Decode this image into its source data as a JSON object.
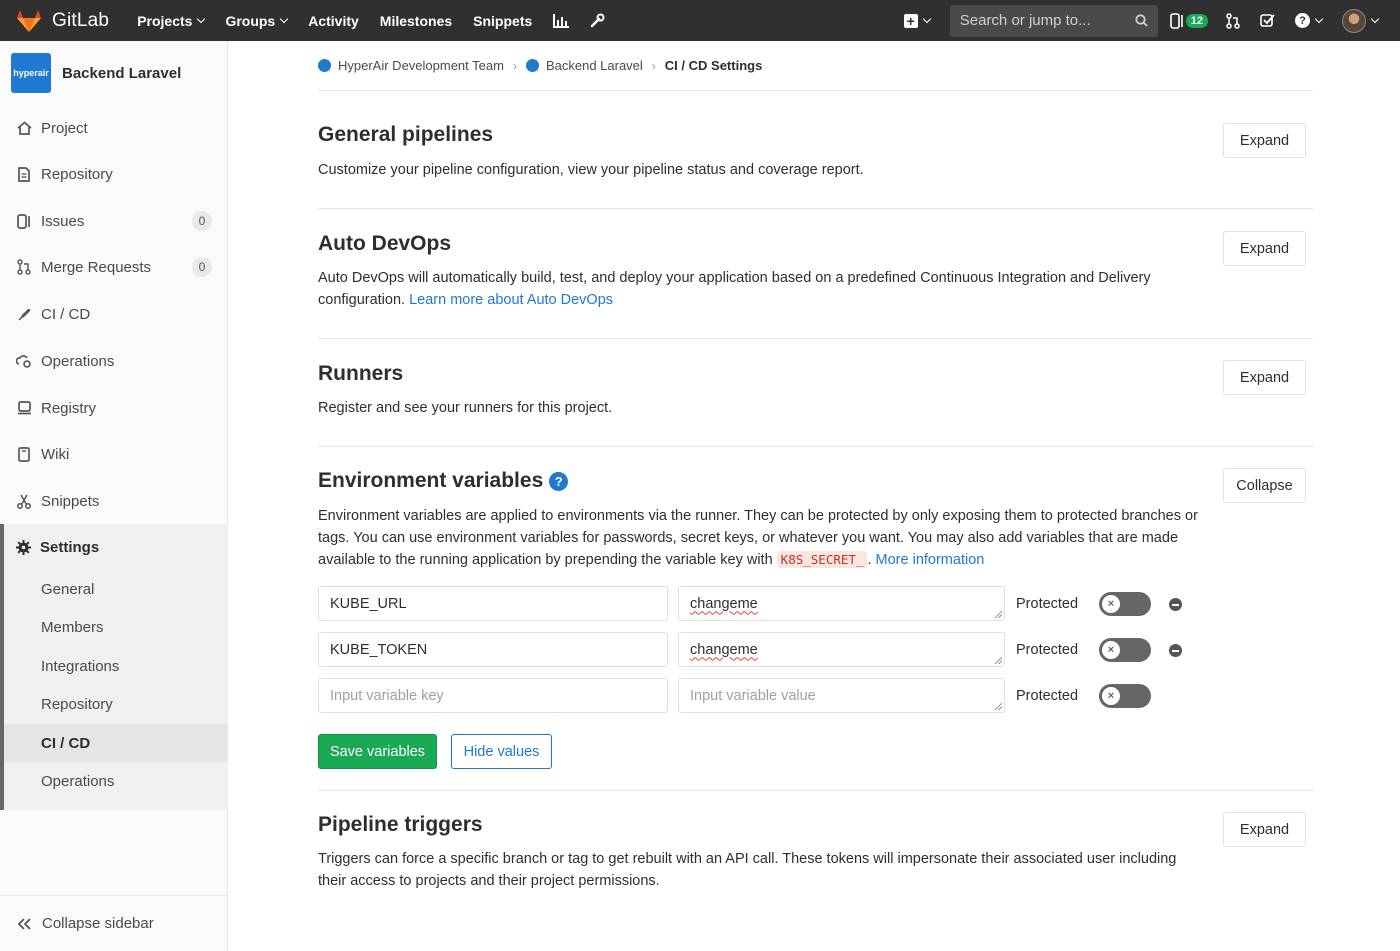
{
  "navbar": {
    "brand": "GitLab",
    "links": [
      {
        "label": "Projects",
        "dropdown": true
      },
      {
        "label": "Groups",
        "dropdown": true
      },
      {
        "label": "Activity",
        "dropdown": false
      },
      {
        "label": "Milestones",
        "dropdown": false
      },
      {
        "label": "Snippets",
        "dropdown": false
      }
    ],
    "search_placeholder": "Search or jump to...",
    "issues_count": "12"
  },
  "sidebar": {
    "project_logo_text": "hyperair",
    "project_name": "Backend Laravel",
    "items": [
      {
        "label": "Project",
        "icon": "home-icon"
      },
      {
        "label": "Repository",
        "icon": "doc-icon"
      },
      {
        "label": "Issues",
        "icon": "issues-icon",
        "count": "0"
      },
      {
        "label": "Merge Requests",
        "icon": "merge-request-icon",
        "count": "0"
      },
      {
        "label": "CI / CD",
        "icon": "rocket-icon"
      },
      {
        "label": "Operations",
        "icon": "cloud-gear-icon"
      },
      {
        "label": "Registry",
        "icon": "container-icon"
      },
      {
        "label": "Wiki",
        "icon": "book-icon"
      },
      {
        "label": "Snippets",
        "icon": "scissors-icon"
      }
    ],
    "settings_label": "Settings",
    "settings_sub": [
      "General",
      "Members",
      "Integrations",
      "Repository",
      "CI / CD",
      "Operations"
    ],
    "active_sub": "CI / CD",
    "collapse_label": "Collapse sidebar"
  },
  "breadcrumb": {
    "group": "HyperAir Development Team",
    "project": "Backend Laravel",
    "current": "CI / CD Settings"
  },
  "sections": {
    "general": {
      "title": "General pipelines",
      "desc": "Customize your pipeline configuration, view your pipeline status and coverage report.",
      "button": "Expand"
    },
    "autodevops": {
      "title": "Auto DevOps",
      "desc": "Auto DevOps will automatically build, test, and deploy your application based on a predefined Continuous Integration and Delivery configuration.",
      "link": "Learn more about Auto DevOps",
      "button": "Expand"
    },
    "runners": {
      "title": "Runners",
      "desc": "Register and see your runners for this project.",
      "button": "Expand"
    },
    "envvars": {
      "title": "Environment variables",
      "desc_pre": "Environment variables are applied to environments via the runner. They can be protected by only exposing them to protected branches or tags. You can use environment variables for passwords, secret keys, or whatever you want. You may also add variables that are made available to the running application by prepending the variable key with",
      "code": "K8S_SECRET_",
      "desc_post": ".",
      "link": "More information",
      "button": "Collapse",
      "variables": [
        {
          "key": "KUBE_URL",
          "value": "changeme",
          "protected_label": "Protected",
          "protected": false
        },
        {
          "key": "KUBE_TOKEN",
          "value": "changeme",
          "protected_label": "Protected",
          "protected": false
        }
      ],
      "new_row": {
        "key_placeholder": "Input variable key",
        "value_placeholder": "Input variable value",
        "protected_label": "Protected"
      },
      "save_button": "Save variables",
      "hide_button": "Hide values"
    },
    "triggers": {
      "title": "Pipeline triggers",
      "desc": "Triggers can force a specific branch or tag to get rebuilt with an API call. These tokens will impersonate their associated user including their access to projects and their project permissions.",
      "button": "Expand"
    }
  },
  "colors": {
    "navbar": "#303030",
    "primary_blue": "#1f78d1",
    "success_green": "#1aaa55",
    "gitlab_orange": "#e24329"
  }
}
